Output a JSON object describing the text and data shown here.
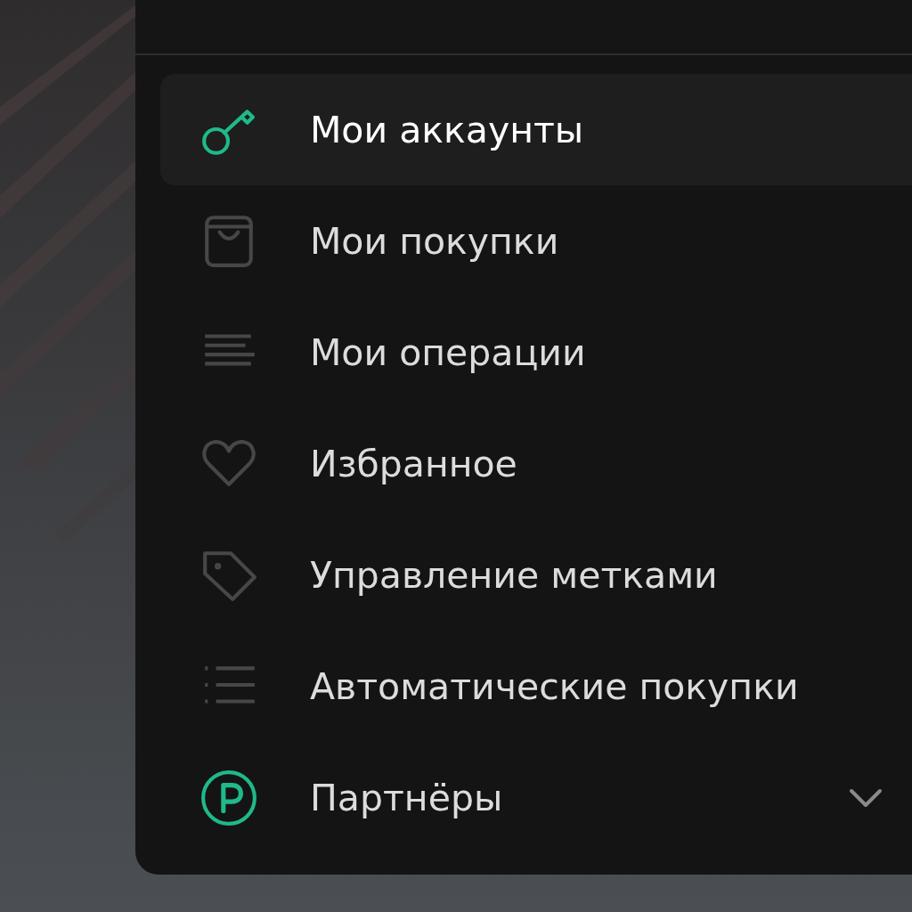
{
  "menu": {
    "items": [
      {
        "kind": "key",
        "label": "Мои аккаунты",
        "selected": true
      },
      {
        "kind": "bag",
        "label": "Мои покупки",
        "selected": false
      },
      {
        "kind": "lines",
        "label": "Мои операции",
        "selected": false
      },
      {
        "kind": "heart",
        "label": "Избранное",
        "selected": false
      },
      {
        "kind": "tag",
        "label": "Управление метками",
        "selected": false
      },
      {
        "kind": "list",
        "label": "Автоматические покупки",
        "selected": false
      },
      {
        "kind": "partner",
        "label": "Партнёры",
        "selected": false,
        "expanded": false
      }
    ]
  }
}
